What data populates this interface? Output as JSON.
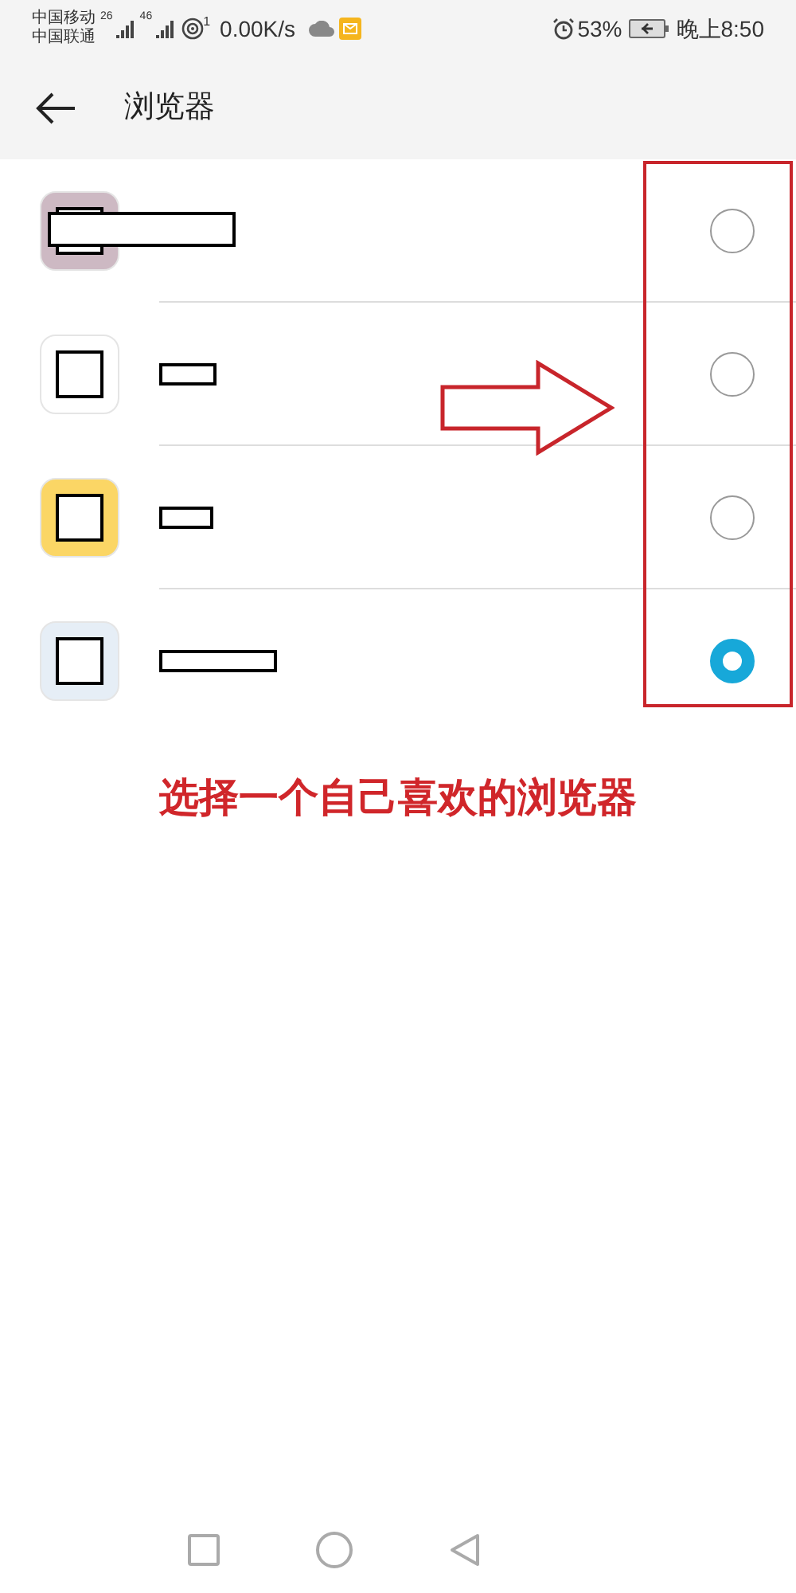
{
  "status_bar": {
    "carriers": [
      "中国移动",
      "中国联通"
    ],
    "signal_labels": [
      "26",
      "46"
    ],
    "hotspot_label": "1",
    "speed": "0.00K/s",
    "battery": "53%",
    "time": "晚上8:50"
  },
  "header": {
    "title": "浏览器"
  },
  "apps": [
    {
      "color": "#cdb9c3",
      "selected": false
    },
    {
      "color": "#ffffff",
      "selected": false
    },
    {
      "color": "#fbd665",
      "selected": false
    },
    {
      "color": "#e6eef6",
      "selected": true
    }
  ],
  "annotation": {
    "caption": "选择一个自己喜欢的浏览器"
  }
}
